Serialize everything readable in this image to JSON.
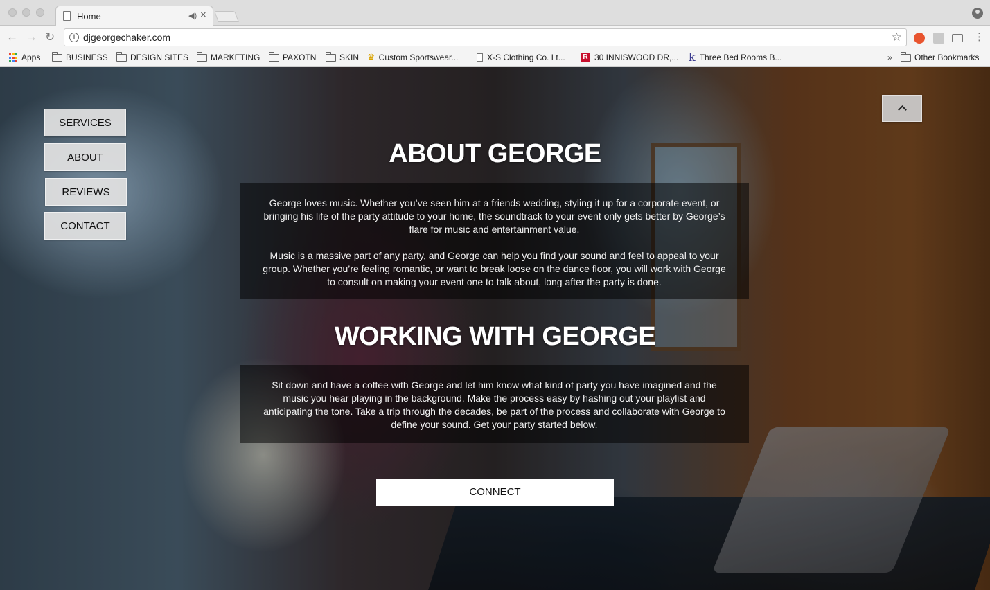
{
  "browser": {
    "tab_title": "Home",
    "url": "djgeorgechaker.com",
    "bookmarks": [
      {
        "label": "Apps",
        "icon": "apps-grid-icon"
      },
      {
        "label": "BUSINESS",
        "icon": "folder-icon"
      },
      {
        "label": "DESIGN SITES",
        "icon": "folder-icon"
      },
      {
        "label": "MARKETING",
        "icon": "folder-icon"
      },
      {
        "label": "PAXOTN",
        "icon": "folder-icon"
      },
      {
        "label": "SKIN",
        "icon": "folder-icon"
      },
      {
        "label": "Custom Sportswear...",
        "icon": "crown-icon"
      },
      {
        "label": "X-S Clothing Co. Lt...",
        "icon": "page-icon"
      },
      {
        "label": "30 INNISWOOD DR,...",
        "icon": "remax-icon"
      },
      {
        "label": "Three Bed Rooms B...",
        "icon": "k-logo-icon"
      }
    ],
    "overflow_chevron": "»",
    "other_bookmarks": "Other Bookmarks"
  },
  "site": {
    "nav": [
      {
        "label": "SERVICES"
      },
      {
        "label": "ABOUT"
      },
      {
        "label": "REVIEWS"
      },
      {
        "label": "CONTACT"
      }
    ],
    "about": {
      "title": "ABOUT GEORGE",
      "paragraphs": [
        "George loves music. Whether you’ve seen him at a friends wedding, styling it up for a corporate event, or bringing his life of the party attitude to your home, the soundtrack to your event only gets better by George’s flare for music and entertainment value.",
        "Music is a massive part of any party, and George can help you find your sound and feel to appeal to your group.  Whether you’re feeling romantic, or want to break loose on the dance floor, you will work with George to consult on making your event one to talk about, long after the party is done."
      ]
    },
    "working": {
      "title": "WORKING WITH GEORGE",
      "paragraph": "Sit down and have a coffee with George and let him know what kind of party you have imagined and the music you hear playing in the background.  Make the process easy by hashing out your playlist and anticipating the tone. Take a trip through the decades, be part of the process and collaborate with George to define your sound. Get your party started below."
    },
    "cta_label": "CONNECT"
  }
}
